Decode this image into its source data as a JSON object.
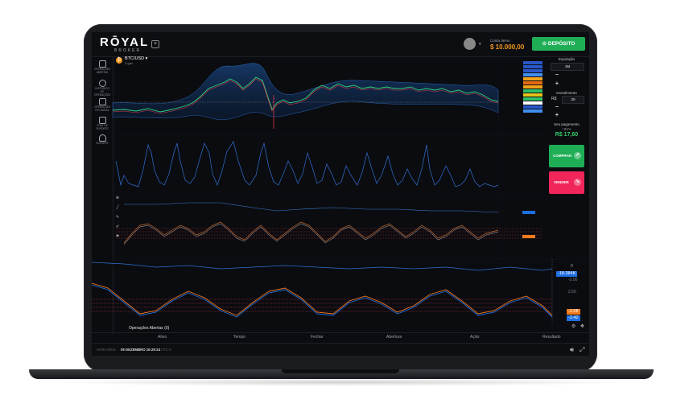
{
  "app": {
    "logo": "RŌYAL",
    "logo_sub": "BROKER",
    "add_tab": "+"
  },
  "header": {
    "account_label": "Conta demo",
    "account_balance": "$ 10.000,00",
    "deposit_label": "DEPÓSITO",
    "caret": "▾"
  },
  "asset": {
    "symbol_icon": "₿",
    "pair": "BTC/USD ▾",
    "sub": "Crypto"
  },
  "sidebar": {
    "items": [
      {
        "label": "OPERAÇÕES ABERTAS",
        "icon": "chart-monitor-icon"
      },
      {
        "label": "HISTÓRICO DE OPERAÇÕES",
        "icon": "clock-icon"
      },
      {
        "label": "OPERAÇÕES FECHADAS",
        "icon": "trophy-icon"
      },
      {
        "label": "CHAT DE SUPORTE",
        "icon": "chat-icon"
      },
      {
        "label": "SUPORTE",
        "icon": "headset-icon"
      }
    ]
  },
  "right_panel": {
    "expiry_label": "Expiração",
    "expiry_value": "1M",
    "minus": "−",
    "plus": "+",
    "investment_label": "Investimento",
    "currency": "R$",
    "investment_value": "20",
    "payout_label": "Seu pagamento",
    "payout_pct": "+88%",
    "payout_value": "R$ 17,60",
    "buy_label": "COMPRAR",
    "sell_label": "VENDER",
    "buy_arrow": "➚",
    "sell_arrow": "➘"
  },
  "indicators": {
    "macd_value": "-18.384K",
    "macd_zero": "0",
    "macd_level": "-2.00",
    "stoch_level": "2.50",
    "stoch_tag_orange": "-2.08",
    "stoch_tag_blue": "-2.42"
  },
  "bottom": {
    "open_ops": "Operações Abertas (0)",
    "columns": [
      "Ativo",
      "Tempo",
      "Fechar",
      "Abertura",
      "Ação",
      "Resultado"
    ],
    "server_time_label": "HORA REAL",
    "server_time": "09 DEZEMBRO 16:29:24",
    "timezone": "UTC-3"
  },
  "colors": {
    "buy": "#1fae55",
    "sell": "#f0255a",
    "balance": "#f29a1a",
    "indicator_blue": "#1e6fe0",
    "indicator_orange": "#f07a1c"
  }
}
